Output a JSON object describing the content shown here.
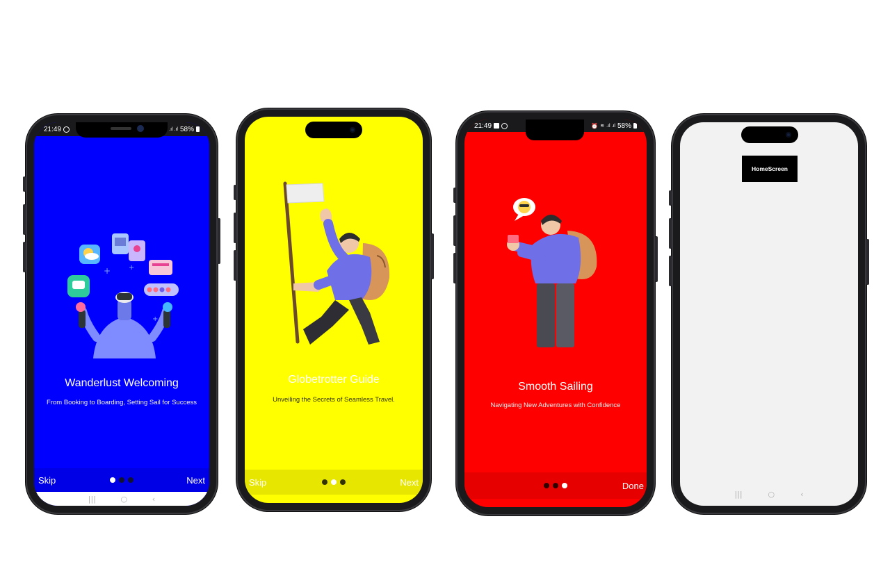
{
  "screens": [
    {
      "status_time": "21:49",
      "status_battery": "58%",
      "title": "Wanderlust Welcoming",
      "subtitle": "From Booking to Boarding, Setting Sail for Success",
      "skip_label": "Skip",
      "next_label": "Next",
      "active_page": 1,
      "background": "#0000FF",
      "bar_color": "#0000E6",
      "dot_active": "#FFFFFF",
      "dot_inactive": "#111133"
    },
    {
      "title": "Globetrotter Guide",
      "subtitle": "Unveiling the Secrets of Seamless Travel.",
      "skip_label": "Skip",
      "next_label": "Next",
      "active_page": 2,
      "background": "#FFFF00",
      "bar_color": "#E6E600",
      "dot_active": "#FFFFFF",
      "dot_inactive": "#333300"
    },
    {
      "status_time": "21:49",
      "status_battery": "58%",
      "title": "Smooth Sailing",
      "subtitle": "Navigating New Adventures with Confidence",
      "done_label": "Done",
      "active_page": 3,
      "background": "#FF0000",
      "bar_color": "#E60000",
      "dot_active": "#FFFFFF",
      "dot_inactive": "#330000"
    },
    {
      "home_label": "HomeScreen",
      "background": "#F2F2F2"
    }
  ],
  "navbar": {
    "recent_icon": "|||",
    "home_icon": "○",
    "back_icon": "‹"
  }
}
